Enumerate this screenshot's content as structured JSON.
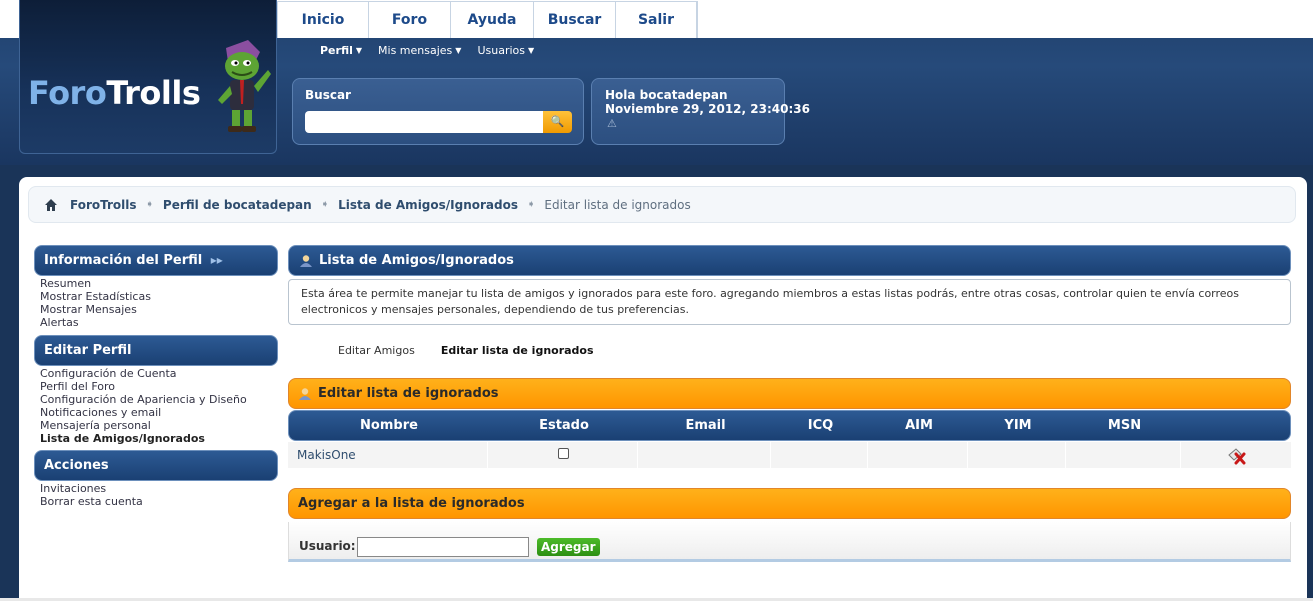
{
  "header": {
    "logo": {
      "part1": "Foro",
      "part2": "Trolls"
    },
    "main_nav": [
      {
        "label": "Inicio"
      },
      {
        "label": "Foro"
      },
      {
        "label": "Ayuda"
      },
      {
        "label": "Buscar"
      },
      {
        "label": "Salir"
      }
    ],
    "sub_nav": [
      {
        "label": "Perfil"
      },
      {
        "label": "Mis mensajes"
      },
      {
        "label": "Usuarios"
      }
    ],
    "search": {
      "label": "Buscar",
      "placeholder": ""
    },
    "user": {
      "greeting": "Hola bocatadepan",
      "datetime": "Noviembre 29, 2012, 23:40:36"
    }
  },
  "breadcrumb": [
    {
      "label": "ForoTrolls"
    },
    {
      "label": "Perfil de bocatadepan"
    },
    {
      "label": "Lista de Amigos/Ignorados"
    },
    {
      "label": "Editar lista de ignorados"
    }
  ],
  "sidebar": {
    "sections": [
      {
        "title": "Información del Perfil",
        "links": [
          "Resumen",
          "Mostrar Estadísticas",
          "Mostrar Mensajes",
          "Alertas"
        ]
      },
      {
        "title": "Editar Perfil",
        "links": [
          "Configuración de Cuenta",
          "Perfil del Foro",
          "Configuración de Apariencia y Diseño",
          "Notificaciones y email",
          "Mensajería personal",
          "Lista de Amigos/Ignorados"
        ]
      },
      {
        "title": "Acciones",
        "links": [
          "Invitaciones",
          "Borrar esta cuenta"
        ]
      }
    ],
    "active_link": "Lista de Amigos/Ignorados"
  },
  "main": {
    "title": "Lista de Amigos/Ignorados",
    "description": "Esta área te permite manejar tu lista de amigos y ignorados para este foro. agregando miembros a estas listas podrás, entre otras cosas, controlar quien te envía correos electronicos y mensajes personales, dependiendo de tus preferencias.",
    "tabs": [
      {
        "label": "Editar Amigos"
      },
      {
        "label": "Editar lista de ignorados"
      }
    ],
    "edit_section_title": "Editar lista de ignorados",
    "table": {
      "columns": [
        "Nombre",
        "Estado",
        "Email",
        "ICQ",
        "AIM",
        "YIM",
        "MSN"
      ],
      "rows": [
        {
          "name": "MakisOne",
          "estado_checked": false
        }
      ]
    },
    "add_section_title": "Agregar a la lista de ignorados",
    "add_form": {
      "label": "Usuario:",
      "button": "Agregar"
    }
  },
  "colors": {
    "blue_bar": "#1f4a80",
    "orange_bar": "#ff9f0a",
    "add_button": "#3aa31d"
  }
}
